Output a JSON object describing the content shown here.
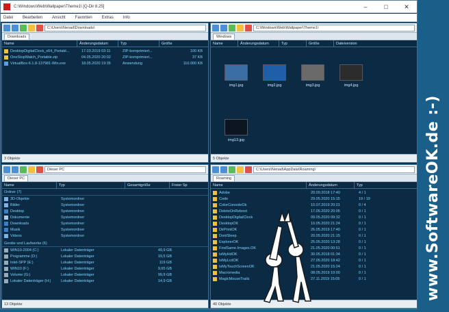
{
  "window": {
    "title": "C:\\Windows\\Web\\Wallpaper\\Theme1\\ [Q-Dir 8.25]"
  },
  "menu": [
    "Datei",
    "Bearbeiten",
    "Ansicht",
    "Favoriten",
    "Extras",
    "Info"
  ],
  "pane_tl": {
    "address": "C:\\Users\\Nenad\\Downloads\\",
    "tab": "Downloads",
    "columns": [
      "Name",
      "Änderungsdatum",
      "Typ",
      "Größe"
    ],
    "rows": [
      {
        "name": "DesktopDigitalClock_x64_Portabl...",
        "date": "17.03.2019 03:11",
        "type": "ZIP-komprimiert...",
        "size": "100 KB"
      },
      {
        "name": "OneStopWatch_Portable.zip",
        "date": "04.05.2020 20:02",
        "type": "ZIP-komprimiert...",
        "size": "37 KB"
      },
      {
        "name": "VirtualBox-6.1.8-137981-Win.exe",
        "date": "18.05.2020 19:35",
        "type": "Anwendung",
        "size": "110.000 KB"
      }
    ],
    "status": "3 Objekte"
  },
  "pane_tr": {
    "address": "C:\\Windows\\Web\\Wallpaper\\Theme1\\",
    "tab": "Windows",
    "columns": [
      "Name",
      "Änderungsdatum",
      "Typ",
      "Größe",
      "Dateiversion"
    ],
    "thumbs": [
      {
        "caption": "img1.jpg",
        "color": "#3a6ea5"
      },
      {
        "caption": "img2.jpg",
        "color": "#1e5fa8"
      },
      {
        "caption": "img3.jpg",
        "color": "#6a6a6a"
      },
      {
        "caption": "img4.jpg",
        "color": "#2c2c2c"
      },
      {
        "caption": "img13.jpg",
        "color": "#0d1520"
      }
    ],
    "status": "5 Objekte"
  },
  "pane_bl": {
    "address": "Dieser PC",
    "tab": "Dieser PC",
    "columns": [
      "Name",
      "Typ",
      "Gesamtgröße",
      "Freier Sp"
    ],
    "group1": "Ordner (7)",
    "folders": [
      {
        "name": "3D-Objekte",
        "type": "Systemordner"
      },
      {
        "name": "Bilder",
        "type": "Systemordner"
      },
      {
        "name": "Desktop",
        "type": "Systemordner"
      },
      {
        "name": "Dokumente",
        "type": "Systemordner"
      },
      {
        "name": "Downloads",
        "type": "Systemordner"
      },
      {
        "name": "Musik",
        "type": "Systemordner"
      },
      {
        "name": "Videos",
        "type": "Systemordner"
      }
    ],
    "group2": "Geräte und Laufwerke (6)",
    "drives": [
      {
        "name": "WIN10-2004 (C:)",
        "type": "Lokaler Datenträger",
        "size": "49,9 GB"
      },
      {
        "name": "Programme (D:)",
        "type": "Lokaler Datenträger",
        "size": "19,5 GB"
      },
      {
        "name": "Intel-SPP (E:)",
        "type": "Lokaler Datenträger",
        "size": "119 GB"
      },
      {
        "name": "WIN10 (F:)",
        "type": "Lokaler Datenträger",
        "size": "9,65 GB"
      },
      {
        "name": "Volume (G:)",
        "type": "Lokaler Datenträger",
        "size": "99,9 GB"
      },
      {
        "name": "Lokaler Datenträger (H:)",
        "type": "Lokaler Datenträger",
        "size": "14,9 GB"
      }
    ],
    "status": "13 Objekte"
  },
  "pane_br": {
    "address": "C:\\Users\\Nenad\\AppData\\Roaming\\",
    "tab": "Roaming",
    "columns": [
      "Name",
      "Änderungsdatum",
      "Typ"
    ],
    "rows": [
      {
        "name": "Adobe",
        "date": "20.09.2018 17:40",
        "type": "4 / 1"
      },
      {
        "name": "Code",
        "date": "29.05.2020 15:15",
        "type": "19 / 19"
      },
      {
        "name": "ColorConsoleOk",
        "date": "10.07.2019 20:21",
        "type": "0 / 4"
      },
      {
        "name": "DeleteOnReboot",
        "date": "17.05.2020 20:05",
        "type": "0 / 1"
      },
      {
        "name": "DesktopDigitalClock",
        "date": "09.05.2020 09:32",
        "type": "0 / 1"
      },
      {
        "name": "DesktopOK",
        "date": "10.05.2020 21:24",
        "type": "0 / 1"
      },
      {
        "name": "DirPrintOK",
        "date": "26.05.2019 17:40",
        "type": "0 / 1"
      },
      {
        "name": "DontSleep",
        "date": "20.05.2020 21:15",
        "type": "0 / 1"
      },
      {
        "name": "ExplorerOK",
        "date": "25.05.2020 13:28",
        "type": "0 / 1"
      },
      {
        "name": "FindSame.Images.OK",
        "date": "21.05.2020 00:51",
        "type": "0 / 1"
      },
      {
        "name": "IsMyHdOK",
        "date": "30.05.2018 01:34",
        "type": "0 / 1"
      },
      {
        "name": "IsMyLcdOK",
        "date": "27.05.2020 18:42",
        "type": "0 / 1"
      },
      {
        "name": "IsMyTouchScreenOK",
        "date": "21.05.2020 15:24",
        "type": "0 / 1"
      },
      {
        "name": "Macromedia",
        "date": "08.05.2019 10:00",
        "type": "0 / 1"
      },
      {
        "name": "MagicMouseTrails",
        "date": "27.11.2019 15:05",
        "type": "0 / 1"
      }
    ],
    "status": "40 Objekte"
  },
  "brand": "www.SoftwareOK.de :-)"
}
